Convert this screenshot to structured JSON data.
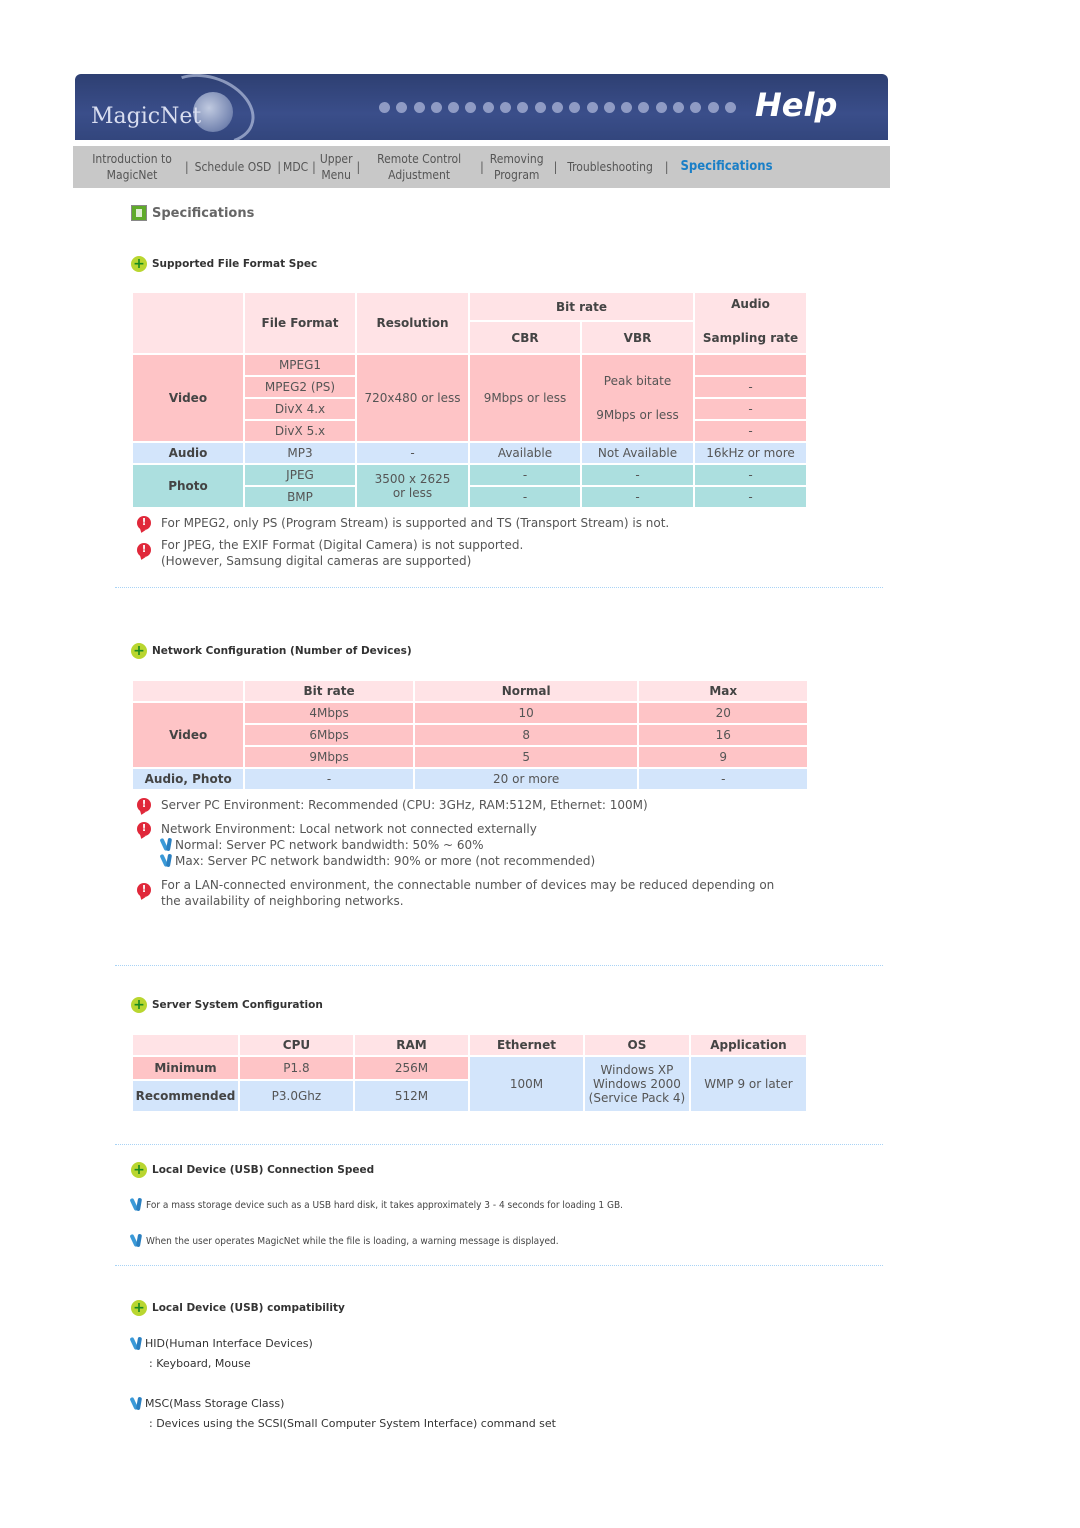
{
  "banner": {
    "logo": "MagicNet",
    "title": "Help"
  },
  "nav": [
    {
      "line1": "Introduction to",
      "line2": "MagicNet"
    },
    {
      "line1": "Schedule OSD",
      "line2": ""
    },
    {
      "line1": "MDC",
      "line2": ""
    },
    {
      "line1": "Upper",
      "line2": "Menu"
    },
    {
      "line1": "Remote Control",
      "line2": "Adjustment"
    },
    {
      "line1": "Removing",
      "line2": "Program"
    },
    {
      "line1": "Troubleshooting",
      "line2": ""
    },
    {
      "line1": "Specifications",
      "line2": ""
    }
  ],
  "nav_separator": "|",
  "page_title": "Specifications",
  "file_format": {
    "title": "Supported File Format Spec",
    "headers": {
      "file_format": "File Format",
      "resolution": "Resolution",
      "bit_rate": "Bit rate",
      "cbr": "CBR",
      "vbr": "VBR",
      "audio1": "Audio",
      "audio2": "Sampling rate"
    },
    "video": {
      "label": "Video",
      "formats": [
        "MPEG1",
        "MPEG2 (PS)",
        "DivX 4.x",
        "DivX 5.x"
      ],
      "resolution": "720x480 or less",
      "cbr": "9Mbps or less",
      "vbr_line1": "Peak bitate",
      "vbr_line2": "9Mbps or less",
      "sampling": [
        "",
        "-",
        "-",
        "-"
      ]
    },
    "audio": {
      "label": "Audio",
      "format": "MP3",
      "resolution": "-",
      "cbr": "Available",
      "vbr": "Not Available",
      "sampling": "16kHz or more"
    },
    "photo": {
      "label": "Photo",
      "formats": [
        "JPEG",
        "BMP"
      ],
      "resolution_line1": "3500 x 2625",
      "resolution_line2": "or less",
      "rows": [
        [
          "-",
          "-",
          "-"
        ],
        [
          "-",
          "-",
          "-"
        ]
      ]
    },
    "notes": [
      [
        "For MPEG2, only PS (Program Stream) is supported and TS (Transport Stream) is not."
      ],
      [
        "For JPEG, the EXIF Format (Digital Camera) is not supported.",
        "(However, Samsung digital cameras are supported)"
      ]
    ]
  },
  "network": {
    "title": "Network Configuration (Number of Devices)",
    "headers": [
      "",
      "Bit rate",
      "Normal",
      "Max"
    ],
    "video_label": "Video",
    "video_rows": [
      [
        "4Mbps",
        "10",
        "20"
      ],
      [
        "6Mbps",
        "8",
        "16"
      ],
      [
        "9Mbps",
        "5",
        "9"
      ]
    ],
    "audio_row": [
      "Audio, Photo",
      "-",
      "20 or more",
      "-"
    ],
    "notes": {
      "server_pc": "Server PC Environment: Recommended (CPU: 3GHz, RAM:512M, Ethernet: 100M)",
      "network_env": "Network Environment: Local network not connected externally",
      "normal": "Normal: Server PC network bandwidth: 50% ~ 60%",
      "max": "Max: Server PC network bandwidth: 90% or more (not recommended)",
      "lan_line1": "For a LAN-connected environment, the connectable number of devices may be reduced depending on",
      "lan_line2": "the availability of neighboring networks."
    }
  },
  "server": {
    "title": "Server System Configuration",
    "headers": [
      "",
      "CPU",
      "RAM",
      "Ethernet",
      "OS",
      "Application"
    ],
    "minimum": {
      "label": "Minimum",
      "cpu": "P1.8",
      "ram": "256M"
    },
    "recommended": {
      "label": "Recommended",
      "cpu": "P3.0Ghz",
      "ram": "512M"
    },
    "ethernet": "100M",
    "os": [
      "Windows XP",
      "Windows 2000",
      "(Service Pack 4)"
    ],
    "application": "WMP 9 or later"
  },
  "usb_speed": {
    "title": "Local Device (USB) Connection Speed",
    "lines": [
      "For a mass storage device such as a USB hard disk, it takes approximately 3 - 4 seconds for loading 1 GB.",
      "When the user operates MagicNet while the file is loading, a warning message is displayed."
    ]
  },
  "usb_compat": {
    "title": "Local Device (USB) compatibility",
    "items": [
      {
        "name": "HID(Human Interface Devices)",
        "detail": ": Keyboard, Mouse"
      },
      {
        "name": "MSC(Mass Storage Class)",
        "detail": ": Devices using the SCSI(Small Computer System Interface) command set"
      }
    ]
  },
  "colors": {
    "banner": "#33467d",
    "nav_bg": "#c8c8c8",
    "nav_active": "#1a7fc7",
    "header_cell": "#ffe3e6",
    "video_cell": "#fec4c6",
    "audio_cell": "#d3e5fb",
    "photo_cell": "#acdfdf",
    "warn": "#e0283a"
  }
}
